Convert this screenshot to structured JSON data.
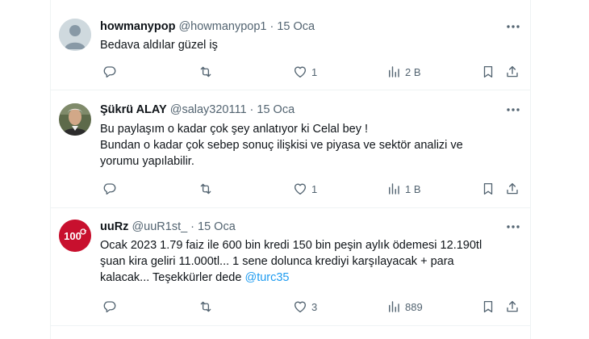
{
  "tweets": [
    {
      "name": "howmanypop",
      "handle": "@howmanypop1",
      "dot": "·",
      "date": "15 Oca",
      "text_lines": [
        "Bedava aldılar güzel iş"
      ],
      "replies": "",
      "retweets": "",
      "likes": "1",
      "views": "2 B"
    },
    {
      "name": "Şükrü ALAY",
      "handle": "@salay320111",
      "dot": "·",
      "date": "15 Oca",
      "text_lines": [
        "Bu paylaşım o kadar çok şey anlatıyor ki Celal bey !",
        "Bundan o kadar çok  sebep sonuç ilişkisi ve piyasa ve sektör analizi ve",
        "yorumu yapılabilir."
      ],
      "replies": "",
      "retweets": "",
      "likes": "1",
      "views": "1 B"
    },
    {
      "name": "uuRz",
      "handle": "@uuR1st_",
      "dot": "·",
      "date": "15 Oca",
      "avatar_text": "100",
      "text_lines": [
        "Ocak 2023 1.79 faiz ile 600 bin kredi 150 bin peşin aylık ödemesi 12.190tl",
        "şuan kira geliri 11.000tl... 1 sene dolunca krediyi karşılayacak + para"
      ],
      "last_line_text": "kalacak... Teşekkürler dede ",
      "mention": "@turc35",
      "replies": "",
      "retweets": "",
      "likes": "3",
      "views": "889"
    }
  ],
  "icons": {
    "reply": "reply-icon",
    "retweet": "retweet-icon",
    "like": "heart-icon",
    "views": "views-icon",
    "bookmark": "bookmark-icon",
    "share": "share-icon",
    "more": "more-icon"
  },
  "colors": {
    "text": "#0f1419",
    "muted": "#536471",
    "mention": "#1d9bf0",
    "divider": "#eff3f4",
    "avatar_red": "#c8102e"
  }
}
